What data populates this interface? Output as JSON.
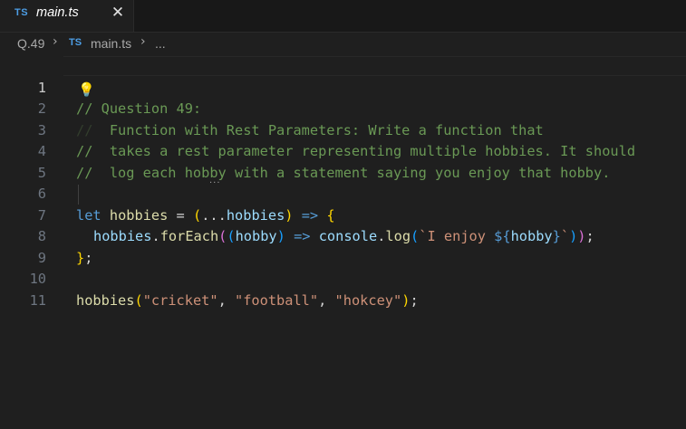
{
  "tab": {
    "badge": "TS",
    "title": "main.ts",
    "close_glyph": "✕"
  },
  "breadcrumb": {
    "folder": "Q.49",
    "file_badge": "TS",
    "file": "main.ts",
    "more": "..."
  },
  "editor": {
    "active_line": 1,
    "lines": [
      {
        "num": "1"
      },
      {
        "num": "2"
      },
      {
        "num": "3"
      },
      {
        "num": "4"
      },
      {
        "num": "5"
      },
      {
        "num": "6"
      },
      {
        "num": "7"
      },
      {
        "num": "8"
      },
      {
        "num": "9"
      },
      {
        "num": "10"
      },
      {
        "num": "11"
      }
    ],
    "tokens": {
      "l1": "// Question 49:",
      "l2_prefix": "//",
      "l2_text": "  Function with Rest Parameters: Write a function that",
      "l3": "//  takes a rest parameter representing multiple hobbies. It should",
      "l4": "//  log each hobby with a statement saying you enjoy that hobby.",
      "l6_let": "let",
      "l6_name": "hobbies",
      "l6_eq": " = ",
      "l6_open": "(",
      "l6_spread": "...",
      "l6_param": "hobbies",
      "l6_close": ")",
      "l6_arrow": " => ",
      "l6_brace": "{",
      "l7_obj": "hobbies",
      "l7_dot": ".",
      "l7_method": "forEach",
      "l7_p1": "(",
      "l7_p2": "(",
      "l7_param": "hobby",
      "l7_p2c": ")",
      "l7_arrow": " => ",
      "l7_console": "console",
      "l7_dot2": ".",
      "l7_log": "log",
      "l7_p3": "(",
      "l7_tpl_start": "`I enjoy ",
      "l7_interp_open": "${",
      "l7_interp_var": "hobby",
      "l7_interp_close": "}",
      "l7_tpl_end": "`",
      "l7_p3c": ")",
      "l7_p1c": ")",
      "l7_semi": ";",
      "l8_brace": "}",
      "l8_semi": ";",
      "l10_fn": "hobbies",
      "l10_open": "(",
      "l10_s1": "\"cricket\"",
      "l10_c1": ", ",
      "l10_s2": "\"football\"",
      "l10_c2": ", ",
      "l10_s3": "\"hokcey\"",
      "l10_close": ")",
      "l10_semi": ";"
    }
  },
  "icons": {
    "lightbulb": "lightbulb-icon",
    "close": "close-icon",
    "chevron": "chevron-right-icon"
  },
  "colors": {
    "background": "#1f1f1f",
    "comment": "#6a9955",
    "keyword": "#569cd6",
    "variable": "#9cdcfe",
    "function": "#dcdcaa",
    "string": "#ce9178",
    "ts_badge": "#4d9ee6"
  }
}
